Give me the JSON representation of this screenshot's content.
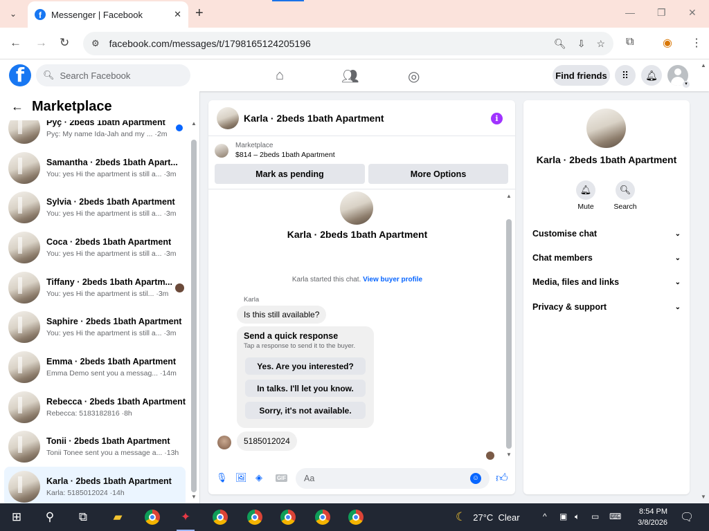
{
  "browser": {
    "tab_title": "Messenger | Facebook",
    "url": "facebook.com/messages/t/1798165124205196"
  },
  "header": {
    "search_placeholder": "Search Facebook",
    "find_friends": "Find friends"
  },
  "sidebar": {
    "title": "Marketplace",
    "conversations": [
      {
        "name": "Ρуҫ · 2beds 1bath Apartment",
        "snippet": "Ρуҫ: My name Ida-Jah and my ... ·2m"
      },
      {
        "name": "Samantha · 2beds 1bath Apart...",
        "snippet": "You: yes Hi the apartment is still a... ·3m"
      },
      {
        "name": "Sylvia · 2beds 1bath Apartment",
        "snippet": "You: yes Hi the apartment is still a... ·3m"
      },
      {
        "name": "Coca · 2beds 1bath Apartment",
        "snippet": "You: yes Hi the apartment is still a... ·3m"
      },
      {
        "name": "Tiffany · 2beds 1bath Apartm...",
        "snippet": "You: yes Hi the apartment is stil... ·3m"
      },
      {
        "name": "Saphire · 2beds 1bath Apartment",
        "snippet": "You: yes Hi the apartment is still a... ·3m"
      },
      {
        "name": "Emma · 2beds 1bath Apartment",
        "snippet": "Emma Demo sent you a messag... ·14m"
      },
      {
        "name": "Rebecca · 2beds 1bath Apartment",
        "snippet": "Rebecca: 5183182816 ·8h"
      },
      {
        "name": "Tonii · 2beds 1bath Apartment",
        "snippet": "Tonii Tonee sent you a message a... ·13h"
      },
      {
        "name": "Karla · 2beds 1bath Apartment",
        "snippet": "Karla: 5185012024 ·14h"
      }
    ]
  },
  "chat": {
    "title": "Karla · 2beds 1bath Apartment",
    "marketplace_label": "Marketplace",
    "listing": "$814 – 2beds 1bath Apartment",
    "mark_pending": "Mark as pending",
    "more_options": "More Options",
    "profile_name": "Karla · 2beds 1bath Apartment",
    "started_text": "Karla started this chat.",
    "buyer_profile_link": "View buyer profile",
    "sender_name": "Karla",
    "message1": "Is this still available?",
    "quick_title": "Send a quick response",
    "quick_sub": "Tap a response to send it to the buyer.",
    "quick_responses": [
      "Yes. Are you interested?",
      "In talks. I'll let you know.",
      "Sorry, it's not available."
    ],
    "message2": "5185012024",
    "composer_placeholder": "Aa"
  },
  "info_panel": {
    "name": "Karla · 2beds 1bath Apartment",
    "mute": "Mute",
    "search": "Search",
    "sections": [
      "Customise chat",
      "Chat members",
      "Media, files and links",
      "Privacy & support"
    ]
  },
  "taskbar": {
    "weather": "27°C  Clear",
    "time": "8:54 PM",
    "date": "3/8/2026"
  },
  "colors": {
    "facebook_blue": "#1877f2",
    "messenger_blue": "#0866ff",
    "active_row": "#ebf5ff",
    "info_purple": "#a033ff"
  }
}
